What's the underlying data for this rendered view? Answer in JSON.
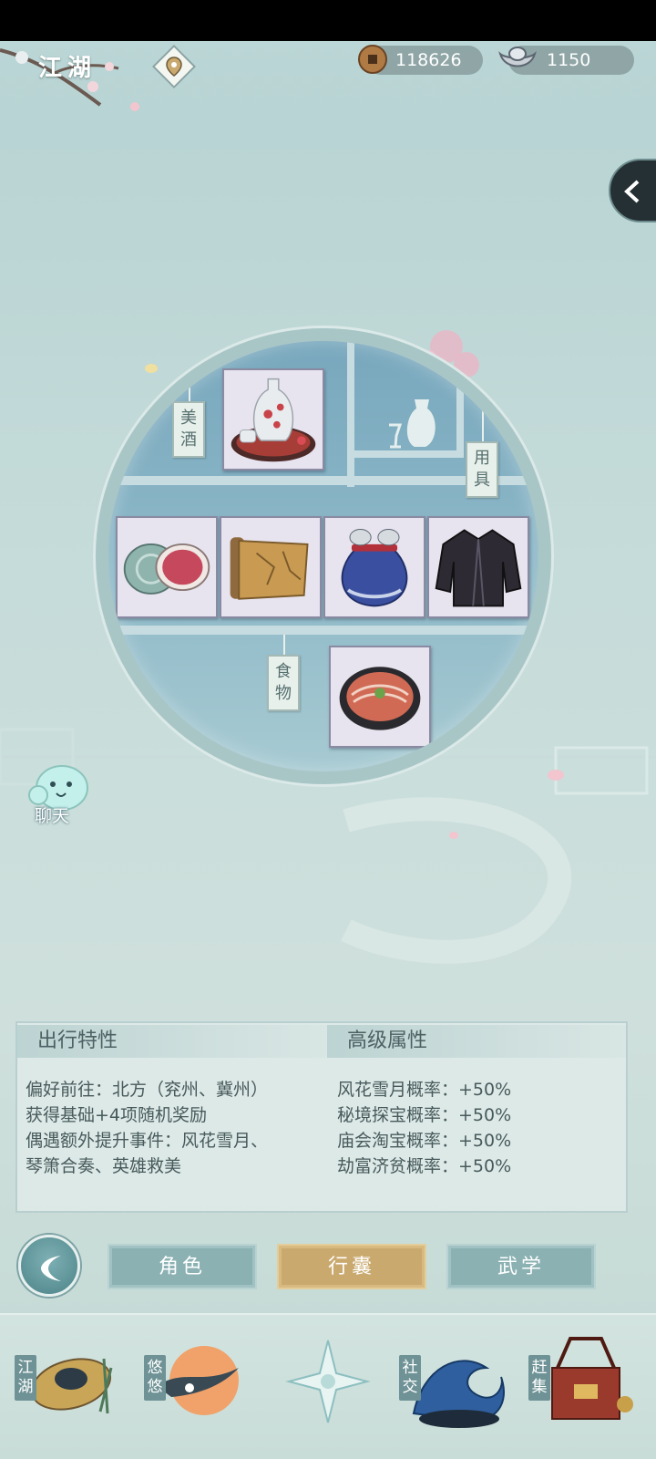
{
  "header": {
    "region_title": "江湖",
    "copper_coins": "118626",
    "silver_ingots": "1150"
  },
  "bag": {
    "shelf_tags": {
      "wine": "美酒",
      "tools": "用具",
      "food": "食物"
    },
    "items": [
      "wine-set",
      "rouge-box",
      "old-map",
      "coin-pouch",
      "dark-robe",
      "sliced-meat-dish"
    ]
  },
  "chat": {
    "label": "聊天"
  },
  "traits": {
    "travel_title": "出行特性",
    "travel_lines": [
      "偏好前往：北方（兖州、冀州）",
      "获得基础+4项随机奖励",
      "偶遇额外提升事件：风花雪月、",
      "琴箫合奏、英雄救美"
    ],
    "advanced_title": "高级属性",
    "advanced_lines": [
      "风花雪月概率：+50%",
      "秘境探宝概率：+50%",
      "庙会淘宝概率：+50%",
      "劫富济贫概率：+50%"
    ]
  },
  "tabs": {
    "role": "角色",
    "bag": "行囊",
    "martial": "武学",
    "active": "bag"
  },
  "bottom_nav": {
    "jianghu": "江湖",
    "youyou": "悠悠",
    "social": "社交",
    "market": "赶集"
  },
  "colors": {
    "active_tab": "#c9a96e",
    "inactive_tab": "#8bb1b3"
  }
}
